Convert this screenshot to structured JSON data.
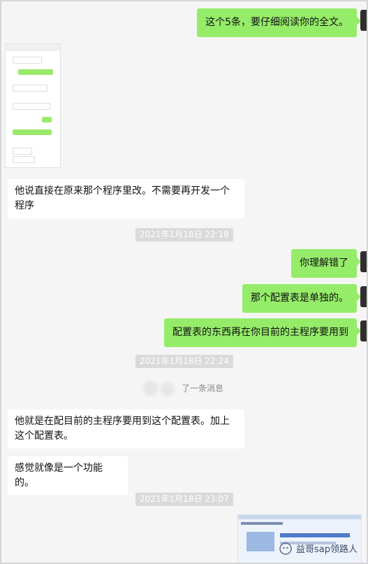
{
  "messages": {
    "m1": "这个5条，要仔细阅读你的全文。",
    "m2": "他说直接在原来那个程序里改。不需要再开发一个程序",
    "ts1": "2021年1月18日 22:18",
    "m3": "你理解错了",
    "m4": "那个配置表是单独的。",
    "m5": "配置表的东西再在你目前的主程序要用到",
    "ts2": "2021年1月18日 22:24",
    "recall": "了一条消息",
    "m6": "他就是在配目前的主程序要用到这个配置表。加上这个配置表。",
    "m7": "感觉就像是一个功能的。",
    "ts3": "2021年1月18日 23:07"
  },
  "watermark": {
    "text": "益哥sap领路人",
    "icon": "wechat-official-account-icon"
  },
  "colors": {
    "chat_bg": "#f5f5f5",
    "my_bubble": "#95ec69",
    "other_bubble": "#ffffff",
    "timestamp_bg": "#dadada"
  }
}
